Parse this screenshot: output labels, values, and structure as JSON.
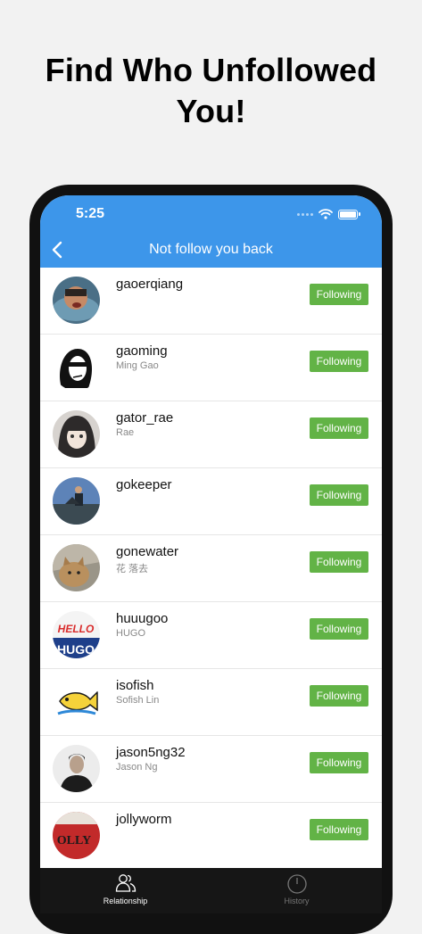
{
  "promo": {
    "headline_line1": "Find Who Unfollowed",
    "headline_line2": "You!"
  },
  "status_bar": {
    "time": "5:25"
  },
  "nav": {
    "title": "Not follow you back",
    "back_icon": "chevron-left-icon"
  },
  "users": [
    {
      "username": "gaoerqiang",
      "display_name": "",
      "button": "Following"
    },
    {
      "username": "gaoming",
      "display_name": "Ming Gao",
      "button": "Following"
    },
    {
      "username": "gator_rae",
      "display_name": "Rae",
      "button": "Following"
    },
    {
      "username": "gokeeper",
      "display_name": "",
      "button": "Following"
    },
    {
      "username": "gonewater",
      "display_name": "花 落去",
      "button": "Following"
    },
    {
      "username": "huuugoo",
      "display_name": "HUGO",
      "button": "Following"
    },
    {
      "username": "isofish",
      "display_name": "Sofish Lin",
      "button": "Following"
    },
    {
      "username": "jason5ng32",
      "display_name": "Jason Ng",
      "button": "Following"
    },
    {
      "username": "jollyworm",
      "display_name": "",
      "button": "Following"
    }
  ],
  "tabs": [
    {
      "label": "Relationship",
      "icon": "people-icon",
      "active": true
    },
    {
      "label": "History",
      "icon": "clock-icon",
      "active": false
    }
  ],
  "colors": {
    "header_blue": "#3d96ea",
    "button_green": "#62b346",
    "tabbar_bg": "#161616",
    "tab_active": "#ffffff",
    "tab_inactive": "#777777"
  }
}
